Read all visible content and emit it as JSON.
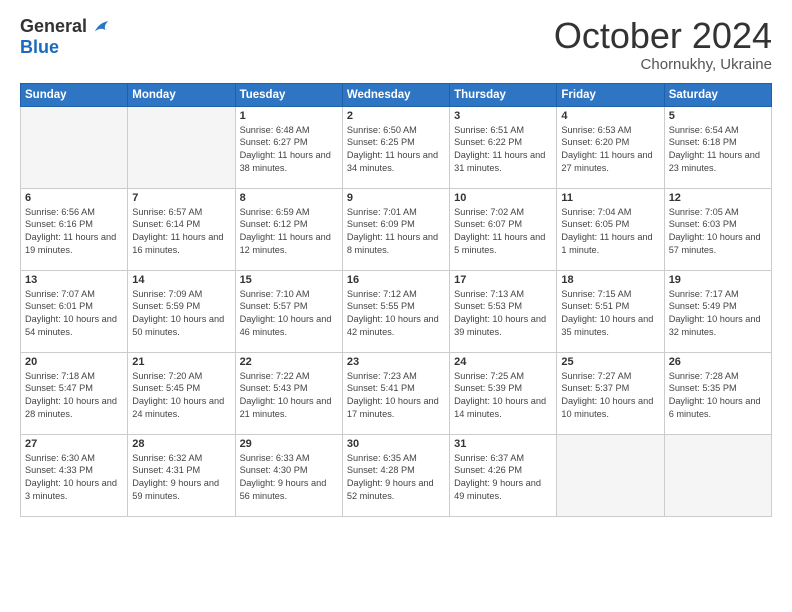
{
  "header": {
    "logo_general": "General",
    "logo_blue": "Blue",
    "month": "October 2024",
    "location": "Chornukhy, Ukraine"
  },
  "weekdays": [
    "Sunday",
    "Monday",
    "Tuesday",
    "Wednesday",
    "Thursday",
    "Friday",
    "Saturday"
  ],
  "weeks": [
    [
      {
        "day": "",
        "info": ""
      },
      {
        "day": "",
        "info": ""
      },
      {
        "day": "1",
        "info": "Sunrise: 6:48 AM\nSunset: 6:27 PM\nDaylight: 11 hours and 38 minutes."
      },
      {
        "day": "2",
        "info": "Sunrise: 6:50 AM\nSunset: 6:25 PM\nDaylight: 11 hours and 34 minutes."
      },
      {
        "day": "3",
        "info": "Sunrise: 6:51 AM\nSunset: 6:22 PM\nDaylight: 11 hours and 31 minutes."
      },
      {
        "day": "4",
        "info": "Sunrise: 6:53 AM\nSunset: 6:20 PM\nDaylight: 11 hours and 27 minutes."
      },
      {
        "day": "5",
        "info": "Sunrise: 6:54 AM\nSunset: 6:18 PM\nDaylight: 11 hours and 23 minutes."
      }
    ],
    [
      {
        "day": "6",
        "info": "Sunrise: 6:56 AM\nSunset: 6:16 PM\nDaylight: 11 hours and 19 minutes."
      },
      {
        "day": "7",
        "info": "Sunrise: 6:57 AM\nSunset: 6:14 PM\nDaylight: 11 hours and 16 minutes."
      },
      {
        "day": "8",
        "info": "Sunrise: 6:59 AM\nSunset: 6:12 PM\nDaylight: 11 hours and 12 minutes."
      },
      {
        "day": "9",
        "info": "Sunrise: 7:01 AM\nSunset: 6:09 PM\nDaylight: 11 hours and 8 minutes."
      },
      {
        "day": "10",
        "info": "Sunrise: 7:02 AM\nSunset: 6:07 PM\nDaylight: 11 hours and 5 minutes."
      },
      {
        "day": "11",
        "info": "Sunrise: 7:04 AM\nSunset: 6:05 PM\nDaylight: 11 hours and 1 minute."
      },
      {
        "day": "12",
        "info": "Sunrise: 7:05 AM\nSunset: 6:03 PM\nDaylight: 10 hours and 57 minutes."
      }
    ],
    [
      {
        "day": "13",
        "info": "Sunrise: 7:07 AM\nSunset: 6:01 PM\nDaylight: 10 hours and 54 minutes."
      },
      {
        "day": "14",
        "info": "Sunrise: 7:09 AM\nSunset: 5:59 PM\nDaylight: 10 hours and 50 minutes."
      },
      {
        "day": "15",
        "info": "Sunrise: 7:10 AM\nSunset: 5:57 PM\nDaylight: 10 hours and 46 minutes."
      },
      {
        "day": "16",
        "info": "Sunrise: 7:12 AM\nSunset: 5:55 PM\nDaylight: 10 hours and 42 minutes."
      },
      {
        "day": "17",
        "info": "Sunrise: 7:13 AM\nSunset: 5:53 PM\nDaylight: 10 hours and 39 minutes."
      },
      {
        "day": "18",
        "info": "Sunrise: 7:15 AM\nSunset: 5:51 PM\nDaylight: 10 hours and 35 minutes."
      },
      {
        "day": "19",
        "info": "Sunrise: 7:17 AM\nSunset: 5:49 PM\nDaylight: 10 hours and 32 minutes."
      }
    ],
    [
      {
        "day": "20",
        "info": "Sunrise: 7:18 AM\nSunset: 5:47 PM\nDaylight: 10 hours and 28 minutes."
      },
      {
        "day": "21",
        "info": "Sunrise: 7:20 AM\nSunset: 5:45 PM\nDaylight: 10 hours and 24 minutes."
      },
      {
        "day": "22",
        "info": "Sunrise: 7:22 AM\nSunset: 5:43 PM\nDaylight: 10 hours and 21 minutes."
      },
      {
        "day": "23",
        "info": "Sunrise: 7:23 AM\nSunset: 5:41 PM\nDaylight: 10 hours and 17 minutes."
      },
      {
        "day": "24",
        "info": "Sunrise: 7:25 AM\nSunset: 5:39 PM\nDaylight: 10 hours and 14 minutes."
      },
      {
        "day": "25",
        "info": "Sunrise: 7:27 AM\nSunset: 5:37 PM\nDaylight: 10 hours and 10 minutes."
      },
      {
        "day": "26",
        "info": "Sunrise: 7:28 AM\nSunset: 5:35 PM\nDaylight: 10 hours and 6 minutes."
      }
    ],
    [
      {
        "day": "27",
        "info": "Sunrise: 6:30 AM\nSunset: 4:33 PM\nDaylight: 10 hours and 3 minutes."
      },
      {
        "day": "28",
        "info": "Sunrise: 6:32 AM\nSunset: 4:31 PM\nDaylight: 9 hours and 59 minutes."
      },
      {
        "day": "29",
        "info": "Sunrise: 6:33 AM\nSunset: 4:30 PM\nDaylight: 9 hours and 56 minutes."
      },
      {
        "day": "30",
        "info": "Sunrise: 6:35 AM\nSunset: 4:28 PM\nDaylight: 9 hours and 52 minutes."
      },
      {
        "day": "31",
        "info": "Sunrise: 6:37 AM\nSunset: 4:26 PM\nDaylight: 9 hours and 49 minutes."
      },
      {
        "day": "",
        "info": ""
      },
      {
        "day": "",
        "info": ""
      }
    ]
  ]
}
